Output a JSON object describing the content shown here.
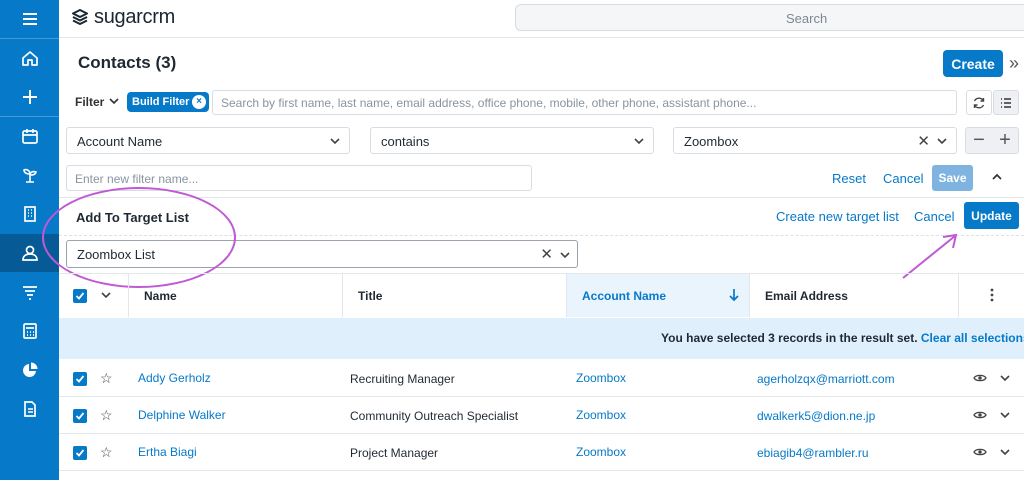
{
  "app": {
    "logo_text": "sugarcrm"
  },
  "topbar": {
    "search_placeholder": "Search"
  },
  "sidebar": {
    "items": [
      "menu-icon",
      "home-icon",
      "plus-icon",
      "calendar-icon",
      "plant-icon",
      "building-icon",
      "contacts-icon",
      "filter-icon",
      "calculator-icon",
      "pie-chart-icon",
      "document-icon"
    ]
  },
  "page": {
    "title": "Contacts (3)",
    "create_label": "Create"
  },
  "filter": {
    "label": "Filter",
    "build_filter": "Build Filter",
    "search_placeholder": "Search by first name, last name, email address, office phone, mobile, other phone, assistant phone...",
    "field": "Account Name",
    "operator": "contains",
    "value": "Zoombox",
    "name_placeholder": "Enter new filter name...",
    "reset": "Reset",
    "cancel": "Cancel",
    "save": "Save"
  },
  "target_list": {
    "title": "Add To Target List",
    "create_new": "Create new target list",
    "cancel": "Cancel",
    "update": "Update",
    "selected": "Zoombox List"
  },
  "table": {
    "columns": [
      "Name",
      "Title",
      "Account Name",
      "Email Address"
    ],
    "banner_text": "You have selected 3 records in the result set.",
    "banner_link": "Clear all selections",
    "rows": [
      {
        "name": "Addy Gerholz",
        "title": "Recruiting Manager",
        "account": "Zoombox",
        "email": "agerholzqx@marriott.com"
      },
      {
        "name": "Delphine Walker",
        "title": "Community Outreach Specialist",
        "account": "Zoombox",
        "email": "dwalkerk5@dion.ne.jp"
      },
      {
        "name": "Ertha Biagi",
        "title": "Project Manager",
        "account": "Zoombox",
        "email": "ebiagib4@rambler.ru"
      }
    ]
  },
  "colors": {
    "brand": "#0679c8",
    "annotation": "#c05ad4"
  }
}
